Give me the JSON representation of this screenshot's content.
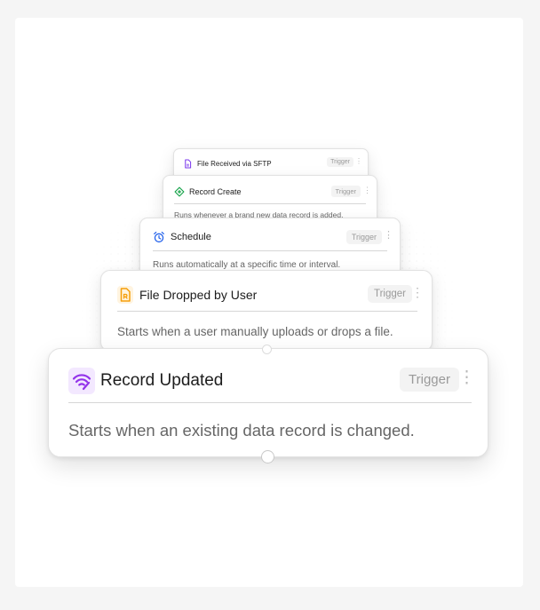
{
  "cards": [
    {
      "title": "File Received via SFTP",
      "tag": "Trigger",
      "icon": "file-icon",
      "accent": "#7c3aed"
    },
    {
      "title": "Record Create",
      "tag": "Trigger",
      "description": "Runs whenever a brand new data record is added.",
      "icon": "plus-diamond-icon",
      "accent": "#16a34a"
    },
    {
      "title": "Schedule",
      "tag": "Trigger",
      "description": "Runs automatically at a specific time or interval.",
      "icon": "alarm-clock-icon",
      "accent": "#2563eb"
    },
    {
      "title": "File Dropped by User",
      "tag": "Trigger",
      "description": "Starts when a user manually uploads or drops a file.",
      "icon": "file-upload-icon",
      "accent": "#f59e0b"
    },
    {
      "title": "Record Updated",
      "tag": "Trigger",
      "description": "Starts when an existing data record is changed.",
      "icon": "signal-update-icon",
      "accent": "#9333ea"
    }
  ],
  "menu_glyph": "⋮"
}
